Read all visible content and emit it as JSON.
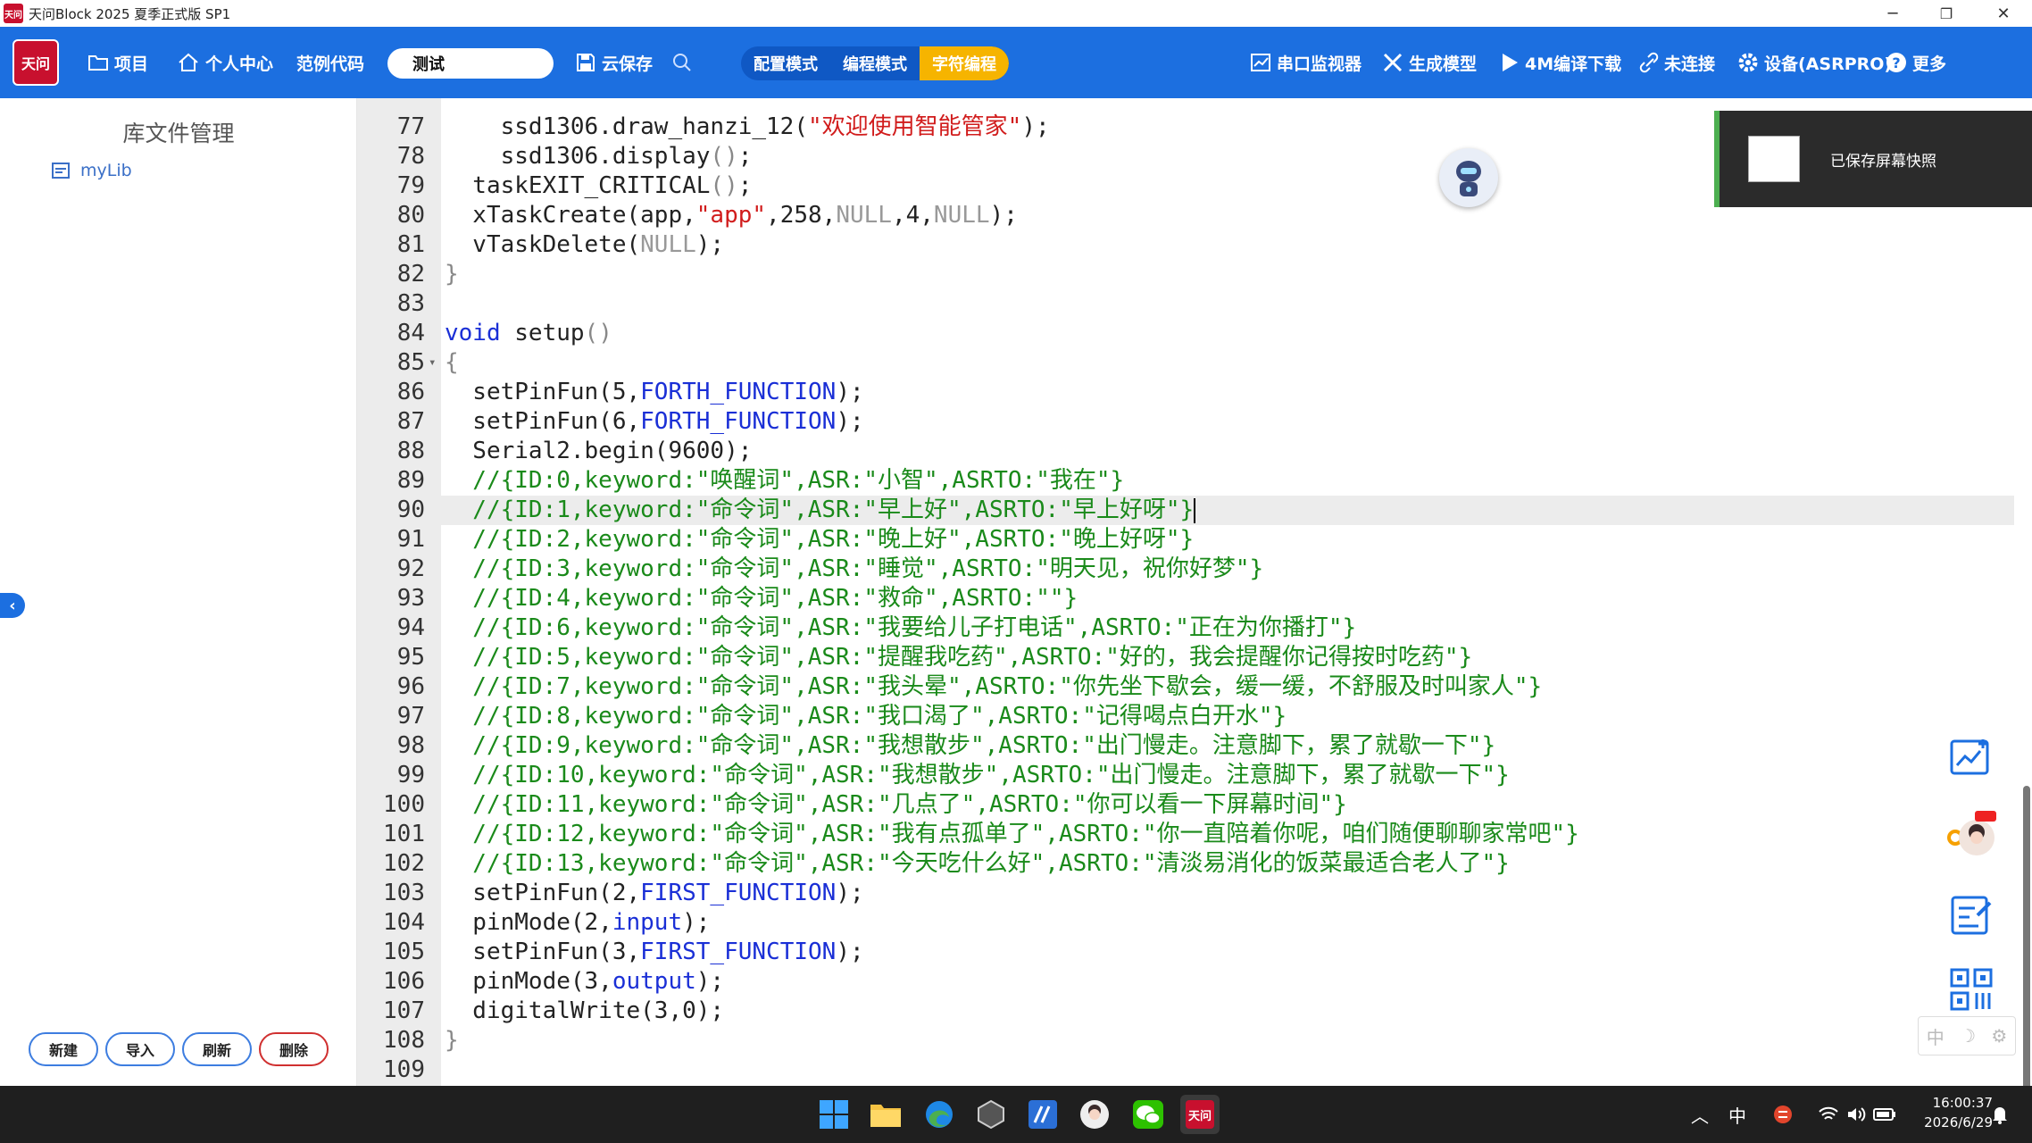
{
  "window": {
    "title": "天问Block 2025 夏季正式版 SP1",
    "logo_text": "天问",
    "minimize": "─",
    "maximize": "❐",
    "close": "✕"
  },
  "toolbar": {
    "logo_text": "天问",
    "project": "项目",
    "personal_center": "个人中心",
    "example_code": "范例代码",
    "project_name": "测试",
    "cloud_save": "云保存",
    "mode_config": "配置模式",
    "mode_program": "编程模式",
    "mode_char": "字符编程",
    "serial_monitor": "串口监视器",
    "generate_model": "生成模型",
    "compile_download": "4M编译下载",
    "not_connected": "未连接",
    "device": "设备(ASRPRO)",
    "more": "更多"
  },
  "sidebar": {
    "title": "库文件管理",
    "items": [
      {
        "label": "myLib"
      }
    ],
    "buttons": {
      "new": "新建",
      "import": "导入",
      "refresh": "刷新",
      "delete": "删除"
    }
  },
  "editor": {
    "active_line": 90,
    "lines": [
      {
        "n": "77",
        "tokens": [
          {
            "t": "    ssd1306.draw_hanzi_12(",
            "c": "k-fn"
          },
          {
            "t": "\"欢迎使用智能管家\"",
            "c": "k-str"
          },
          {
            "t": ");",
            "c": "k-fn"
          }
        ]
      },
      {
        "n": "78",
        "tokens": [
          {
            "t": "    ssd1306.display",
            "c": "k-fn"
          },
          {
            "t": "()",
            "c": "k-paren"
          },
          {
            "t": ";",
            "c": "k-fn"
          }
        ]
      },
      {
        "n": "79",
        "tokens": [
          {
            "t": "  taskEXIT_CRITICAL",
            "c": "k-fn"
          },
          {
            "t": "()",
            "c": "k-paren"
          },
          {
            "t": ";",
            "c": "k-fn"
          }
        ]
      },
      {
        "n": "80",
        "tokens": [
          {
            "t": "  xTaskCreate(app,",
            "c": "k-fn"
          },
          {
            "t": "\"app\"",
            "c": "k-str"
          },
          {
            "t": ",258,",
            "c": "k-fn"
          },
          {
            "t": "NULL",
            "c": "k-null"
          },
          {
            "t": ",4,",
            "c": "k-fn"
          },
          {
            "t": "NULL",
            "c": "k-null"
          },
          {
            "t": ");",
            "c": "k-fn"
          }
        ]
      },
      {
        "n": "81",
        "tokens": [
          {
            "t": "  vTaskDelete(",
            "c": "k-fn"
          },
          {
            "t": "NULL",
            "c": "k-null"
          },
          {
            "t": ");",
            "c": "k-fn"
          }
        ]
      },
      {
        "n": "82",
        "tokens": [
          {
            "t": "}",
            "c": "k-paren"
          }
        ]
      },
      {
        "n": "83",
        "tokens": []
      },
      {
        "n": "84",
        "tokens": [
          {
            "t": "void",
            "c": "k-blue"
          },
          {
            "t": " setup",
            "c": "k-fn"
          },
          {
            "t": "()",
            "c": "k-paren"
          }
        ]
      },
      {
        "n": "85",
        "fold": "▾",
        "tokens": [
          {
            "t": "{",
            "c": "k-paren"
          }
        ]
      },
      {
        "n": "86",
        "tokens": [
          {
            "t": "  setPinFun(5,",
            "c": "k-fn"
          },
          {
            "t": "FORTH_FUNCTION",
            "c": "k-blue"
          },
          {
            "t": ");",
            "c": "k-fn"
          }
        ]
      },
      {
        "n": "87",
        "tokens": [
          {
            "t": "  setPinFun(6,",
            "c": "k-fn"
          },
          {
            "t": "FORTH_FUNCTION",
            "c": "k-blue"
          },
          {
            "t": ");",
            "c": "k-fn"
          }
        ]
      },
      {
        "n": "88",
        "tokens": [
          {
            "t": "  Serial2.begin(9600);",
            "c": "k-fn"
          }
        ]
      },
      {
        "n": "89",
        "tokens": [
          {
            "t": "  //{ID:0,keyword:\"唤醒词\",ASR:\"小智\",ASRTO:\"我在\"}",
            "c": "k-cmt"
          }
        ]
      },
      {
        "n": "90",
        "tokens": [
          {
            "t": "  //{ID:1,keyword:\"命令词\",ASR:\"早上好\",ASRTO:\"早上好呀\"}",
            "c": "k-cmt"
          }
        ]
      },
      {
        "n": "91",
        "tokens": [
          {
            "t": "  //{ID:2,keyword:\"命令词\",ASR:\"晚上好\",ASRTO:\"晚上好呀\"}",
            "c": "k-cmt"
          }
        ]
      },
      {
        "n": "92",
        "tokens": [
          {
            "t": "  //{ID:3,keyword:\"命令词\",ASR:\"睡觉\",ASRTO:\"明天见，祝你好梦\"}",
            "c": "k-cmt"
          }
        ]
      },
      {
        "n": "93",
        "tokens": [
          {
            "t": "  //{ID:4,keyword:\"命令词\",ASR:\"救命\",ASRTO:\"\"}",
            "c": "k-cmt"
          }
        ]
      },
      {
        "n": "94",
        "tokens": [
          {
            "t": "  //{ID:6,keyword:\"命令词\",ASR:\"我要给儿子打电话\",ASRTO:\"正在为你播打\"}",
            "c": "k-cmt"
          }
        ]
      },
      {
        "n": "95",
        "tokens": [
          {
            "t": "  //{ID:5,keyword:\"命令词\",ASR:\"提醒我吃药\",ASRTO:\"好的，我会提醒你记得按时吃药\"}",
            "c": "k-cmt"
          }
        ]
      },
      {
        "n": "96",
        "tokens": [
          {
            "t": "  //{ID:7,keyword:\"命令词\",ASR:\"我头晕\",ASRTO:\"你先坐下歇会，缓一缓，不舒服及时叫家人\"}",
            "c": "k-cmt"
          }
        ]
      },
      {
        "n": "97",
        "tokens": [
          {
            "t": "  //{ID:8,keyword:\"命令词\",ASR:\"我口渴了\",ASRTO:\"记得喝点白开水\"}",
            "c": "k-cmt"
          }
        ]
      },
      {
        "n": "98",
        "tokens": [
          {
            "t": "  //{ID:9,keyword:\"命令词\",ASR:\"我想散步\",ASRTO:\"出门慢走。注意脚下，累了就歇一下\"}",
            "c": "k-cmt"
          }
        ]
      },
      {
        "n": "99",
        "tokens": [
          {
            "t": "  //{ID:10,keyword:\"命令词\",ASR:\"我想散步\",ASRTO:\"出门慢走。注意脚下，累了就歇一下\"}",
            "c": "k-cmt"
          }
        ]
      },
      {
        "n": "100",
        "tokens": [
          {
            "t": "  //{ID:11,keyword:\"命令词\",ASR:\"几点了\",ASRTO:\"你可以看一下屏幕时间\"}",
            "c": "k-cmt"
          }
        ]
      },
      {
        "n": "101",
        "tokens": [
          {
            "t": "  //{ID:12,keyword:\"命令词\",ASR:\"我有点孤单了\",ASRTO:\"你一直陪着你呢，咱们随便聊聊家常吧\"}",
            "c": "k-cmt"
          }
        ]
      },
      {
        "n": "102",
        "tokens": [
          {
            "t": "  //{ID:13,keyword:\"命令词\",ASR:\"今天吃什么好\",ASRTO:\"清淡易消化的饭菜最适合老人了\"}",
            "c": "k-cmt"
          }
        ]
      },
      {
        "n": "103",
        "tokens": [
          {
            "t": "  setPinFun(2,",
            "c": "k-fn"
          },
          {
            "t": "FIRST_FUNCTION",
            "c": "k-blue"
          },
          {
            "t": ");",
            "c": "k-fn"
          }
        ]
      },
      {
        "n": "104",
        "tokens": [
          {
            "t": "  pinMode(2,",
            "c": "k-fn"
          },
          {
            "t": "input",
            "c": "k-blue"
          },
          {
            "t": ");",
            "c": "k-fn"
          }
        ]
      },
      {
        "n": "105",
        "tokens": [
          {
            "t": "  setPinFun(3,",
            "c": "k-fn"
          },
          {
            "t": "FIRST_FUNCTION",
            "c": "k-blue"
          },
          {
            "t": ");",
            "c": "k-fn"
          }
        ]
      },
      {
        "n": "106",
        "tokens": [
          {
            "t": "  pinMode(3,",
            "c": "k-fn"
          },
          {
            "t": "output",
            "c": "k-blue"
          },
          {
            "t": ");",
            "c": "k-fn"
          }
        ]
      },
      {
        "n": "107",
        "tokens": [
          {
            "t": "  digitalWrite(3,0);",
            "c": "k-fn"
          }
        ]
      },
      {
        "n": "108",
        "tokens": [
          {
            "t": "}",
            "c": "k-paren"
          }
        ]
      },
      {
        "n": "109",
        "tokens": []
      }
    ]
  },
  "toast": {
    "message": "已保存屏幕快照"
  },
  "ime": {
    "text": "中"
  },
  "taskbar": {
    "ime_indicator": "中",
    "time": "16:00:37",
    "date": "2026/6/29"
  },
  "colors": {
    "toolbar": "#1c6fe0",
    "accent_yellow": "#f6b400",
    "brand_red": "#c8102e",
    "comment_green": "#1a8a1a",
    "string_red": "#d11c1c",
    "keyword_blue": "#1a2fd6"
  }
}
